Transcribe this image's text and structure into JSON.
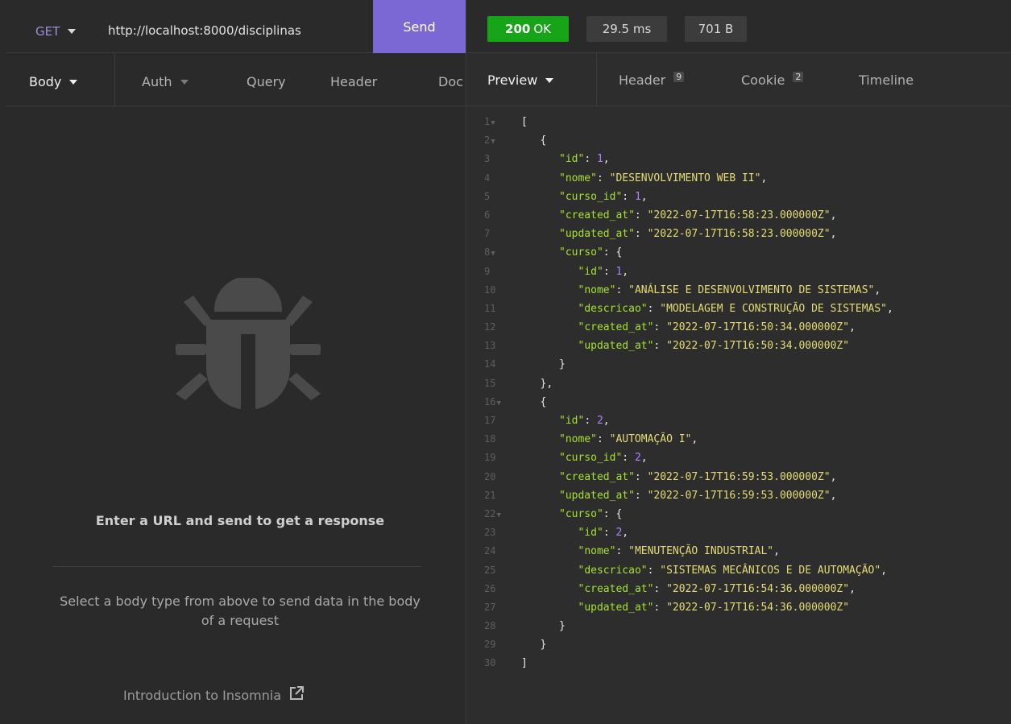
{
  "request": {
    "method": "GET",
    "url": "http://localhost:8000/disciplinas",
    "send_label": "Send",
    "tabs": [
      {
        "label": "Body",
        "active": true,
        "dropdown": true
      },
      {
        "label": "Auth",
        "active": false,
        "dropdown": true
      },
      {
        "label": "Query",
        "active": false,
        "dropdown": false
      },
      {
        "label": "Header",
        "active": false,
        "dropdown": false
      },
      {
        "label": "Doc",
        "active": false,
        "dropdown": false
      }
    ],
    "empty_state": {
      "icon": "bug-icon",
      "title": "Enter a URL and send to get a response",
      "hint": "Select a body type from above to send data in the body of a request",
      "link_label": "Introduction to Insomnia",
      "link_icon": "external-link-icon"
    }
  },
  "response": {
    "status_code": "200",
    "status_text": "OK",
    "time": "29.5 ms",
    "size": "701 B",
    "tabs": [
      {
        "label": "Preview",
        "active": true,
        "dropdown": true,
        "count": ""
      },
      {
        "label": "Header",
        "active": false,
        "dropdown": false,
        "count": "9"
      },
      {
        "label": "Cookie",
        "active": false,
        "dropdown": false,
        "count": "2"
      },
      {
        "label": "Timeline",
        "active": false,
        "dropdown": false,
        "count": ""
      }
    ],
    "lines": [
      {
        "n": "1",
        "fold": true,
        "indent": 0,
        "tokens": [
          [
            "p",
            "["
          ]
        ]
      },
      {
        "n": "2",
        "fold": true,
        "indent": 1,
        "tokens": [
          [
            "p",
            "{"
          ]
        ]
      },
      {
        "n": "3",
        "fold": false,
        "indent": 2,
        "tokens": [
          [
            "k",
            "\"id\""
          ],
          [
            "p",
            ": "
          ],
          [
            "n",
            "1"
          ],
          [
            "p",
            ","
          ]
        ]
      },
      {
        "n": "4",
        "fold": false,
        "indent": 2,
        "tokens": [
          [
            "k",
            "\"nome\""
          ],
          [
            "p",
            ": "
          ],
          [
            "s",
            "\"DESENVOLVIMENTO WEB II\""
          ],
          [
            "p",
            ","
          ]
        ]
      },
      {
        "n": "5",
        "fold": false,
        "indent": 2,
        "tokens": [
          [
            "k",
            "\"curso_id\""
          ],
          [
            "p",
            ": "
          ],
          [
            "n",
            "1"
          ],
          [
            "p",
            ","
          ]
        ]
      },
      {
        "n": "6",
        "fold": false,
        "indent": 2,
        "tokens": [
          [
            "k",
            "\"created_at\""
          ],
          [
            "p",
            ": "
          ],
          [
            "s",
            "\"2022-07-17T16:58:23.000000Z\""
          ],
          [
            "p",
            ","
          ]
        ]
      },
      {
        "n": "7",
        "fold": false,
        "indent": 2,
        "tokens": [
          [
            "k",
            "\"updated_at\""
          ],
          [
            "p",
            ": "
          ],
          [
            "s",
            "\"2022-07-17T16:58:23.000000Z\""
          ],
          [
            "p",
            ","
          ]
        ]
      },
      {
        "n": "8",
        "fold": true,
        "indent": 2,
        "tokens": [
          [
            "k",
            "\"curso\""
          ],
          [
            "p",
            ": {"
          ]
        ]
      },
      {
        "n": "9",
        "fold": false,
        "indent": 3,
        "tokens": [
          [
            "k",
            "\"id\""
          ],
          [
            "p",
            ": "
          ],
          [
            "n",
            "1"
          ],
          [
            "p",
            ","
          ]
        ]
      },
      {
        "n": "10",
        "fold": false,
        "indent": 3,
        "tokens": [
          [
            "k",
            "\"nome\""
          ],
          [
            "p",
            ": "
          ],
          [
            "s",
            "\"ANÁLISE E DESENVOLVIMENTO DE SISTEMAS\""
          ],
          [
            "p",
            ","
          ]
        ]
      },
      {
        "n": "11",
        "fold": false,
        "indent": 3,
        "tokens": [
          [
            "k",
            "\"descricao\""
          ],
          [
            "p",
            ": "
          ],
          [
            "s",
            "\"MODELAGEM E CONSTRUÇÃO DE SISTEMAS\""
          ],
          [
            "p",
            ","
          ]
        ]
      },
      {
        "n": "12",
        "fold": false,
        "indent": 3,
        "tokens": [
          [
            "k",
            "\"created_at\""
          ],
          [
            "p",
            ": "
          ],
          [
            "s",
            "\"2022-07-17T16:50:34.000000Z\""
          ],
          [
            "p",
            ","
          ]
        ]
      },
      {
        "n": "13",
        "fold": false,
        "indent": 3,
        "tokens": [
          [
            "k",
            "\"updated_at\""
          ],
          [
            "p",
            ": "
          ],
          [
            "s",
            "\"2022-07-17T16:50:34.000000Z\""
          ]
        ]
      },
      {
        "n": "14",
        "fold": false,
        "indent": 2,
        "tokens": [
          [
            "p",
            "}"
          ]
        ]
      },
      {
        "n": "15",
        "fold": false,
        "indent": 1,
        "tokens": [
          [
            "p",
            "},"
          ]
        ]
      },
      {
        "n": "16",
        "fold": true,
        "indent": 1,
        "tokens": [
          [
            "p",
            "{"
          ]
        ]
      },
      {
        "n": "17",
        "fold": false,
        "indent": 2,
        "tokens": [
          [
            "k",
            "\"id\""
          ],
          [
            "p",
            ": "
          ],
          [
            "n",
            "2"
          ],
          [
            "p",
            ","
          ]
        ]
      },
      {
        "n": "18",
        "fold": false,
        "indent": 2,
        "tokens": [
          [
            "k",
            "\"nome\""
          ],
          [
            "p",
            ": "
          ],
          [
            "s",
            "\"AUTOMAÇÃO I\""
          ],
          [
            "p",
            ","
          ]
        ]
      },
      {
        "n": "19",
        "fold": false,
        "indent": 2,
        "tokens": [
          [
            "k",
            "\"curso_id\""
          ],
          [
            "p",
            ": "
          ],
          [
            "n",
            "2"
          ],
          [
            "p",
            ","
          ]
        ]
      },
      {
        "n": "20",
        "fold": false,
        "indent": 2,
        "tokens": [
          [
            "k",
            "\"created_at\""
          ],
          [
            "p",
            ": "
          ],
          [
            "s",
            "\"2022-07-17T16:59:53.000000Z\""
          ],
          [
            "p",
            ","
          ]
        ]
      },
      {
        "n": "21",
        "fold": false,
        "indent": 2,
        "tokens": [
          [
            "k",
            "\"updated_at\""
          ],
          [
            "p",
            ": "
          ],
          [
            "s",
            "\"2022-07-17T16:59:53.000000Z\""
          ],
          [
            "p",
            ","
          ]
        ]
      },
      {
        "n": "22",
        "fold": true,
        "indent": 2,
        "tokens": [
          [
            "k",
            "\"curso\""
          ],
          [
            "p",
            ": {"
          ]
        ]
      },
      {
        "n": "23",
        "fold": false,
        "indent": 3,
        "tokens": [
          [
            "k",
            "\"id\""
          ],
          [
            "p",
            ": "
          ],
          [
            "n",
            "2"
          ],
          [
            "p",
            ","
          ]
        ]
      },
      {
        "n": "24",
        "fold": false,
        "indent": 3,
        "tokens": [
          [
            "k",
            "\"nome\""
          ],
          [
            "p",
            ": "
          ],
          [
            "s",
            "\"MENUTENÇÃO INDUSTRIAL\""
          ],
          [
            "p",
            ","
          ]
        ]
      },
      {
        "n": "25",
        "fold": false,
        "indent": 3,
        "tokens": [
          [
            "k",
            "\"descricao\""
          ],
          [
            "p",
            ": "
          ],
          [
            "s",
            "\"SISTEMAS MECÂNICOS E DE AUTOMAÇÃO\""
          ],
          [
            "p",
            ","
          ]
        ]
      },
      {
        "n": "26",
        "fold": false,
        "indent": 3,
        "tokens": [
          [
            "k",
            "\"created_at\""
          ],
          [
            "p",
            ": "
          ],
          [
            "s",
            "\"2022-07-17T16:54:36.000000Z\""
          ],
          [
            "p",
            ","
          ]
        ]
      },
      {
        "n": "27",
        "fold": false,
        "indent": 3,
        "tokens": [
          [
            "k",
            "\"updated_at\""
          ],
          [
            "p",
            ": "
          ],
          [
            "s",
            "\"2022-07-17T16:54:36.000000Z\""
          ]
        ]
      },
      {
        "n": "28",
        "fold": false,
        "indent": 2,
        "tokens": [
          [
            "p",
            "}"
          ]
        ]
      },
      {
        "n": "29",
        "fold": false,
        "indent": 1,
        "tokens": [
          [
            "p",
            "}"
          ]
        ]
      },
      {
        "n": "30",
        "fold": false,
        "indent": 0,
        "tokens": [
          [
            "p",
            "]"
          ]
        ]
      }
    ]
  },
  "colors": {
    "send_button": "#7b68d4",
    "status_ok": "#18a418",
    "json_key": "#a6e22e",
    "json_string": "#e6db74",
    "json_number": "#ae81ff",
    "method": "#a08dd9"
  }
}
